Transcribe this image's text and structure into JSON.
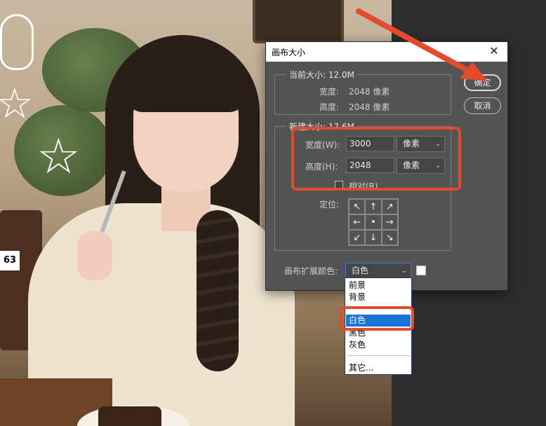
{
  "dialog": {
    "title": "画布大小",
    "current_size": {
      "label": "当前大小:",
      "value": "12.0M",
      "width_label": "宽度:",
      "width_value": "2048 像素",
      "height_label": "高度:",
      "height_value": "2048 像素"
    },
    "new_size": {
      "label": "新建大小:",
      "value": "17.6M",
      "width_label": "宽度(W):",
      "width_value": "3000",
      "width_unit": "像素",
      "height_label": "高度(H):",
      "height_value": "2048",
      "height_unit": "像素",
      "relative_label": "相对(R)",
      "relative_checked": false,
      "anchor_label": "定位:"
    },
    "ok_label": "确定",
    "cancel_label": "取消",
    "extension_color_label": "画布扩展颜色:",
    "extension_color_value": "白色",
    "extension_swatch_color": "#ffffff"
  },
  "dropdown": {
    "options": [
      "前景",
      "背景",
      "白色",
      "黑色",
      "灰色",
      "其它..."
    ],
    "selected": "白色"
  },
  "anchor_icons": [
    "arrow-up-left-icon",
    "arrow-up-icon",
    "arrow-up-right-icon",
    "arrow-left-icon",
    "center-dot-icon",
    "arrow-right-icon",
    "arrow-down-left-icon",
    "arrow-down-icon",
    "arrow-down-right-icon"
  ],
  "anchor_glyphs": [
    "↖",
    "↑",
    "↗",
    "←",
    "•",
    "→",
    "↙",
    "↓",
    "↘"
  ],
  "photo_badge": "63",
  "annotation_color": "#e24b2b",
  "selection_color": "#1874d6"
}
